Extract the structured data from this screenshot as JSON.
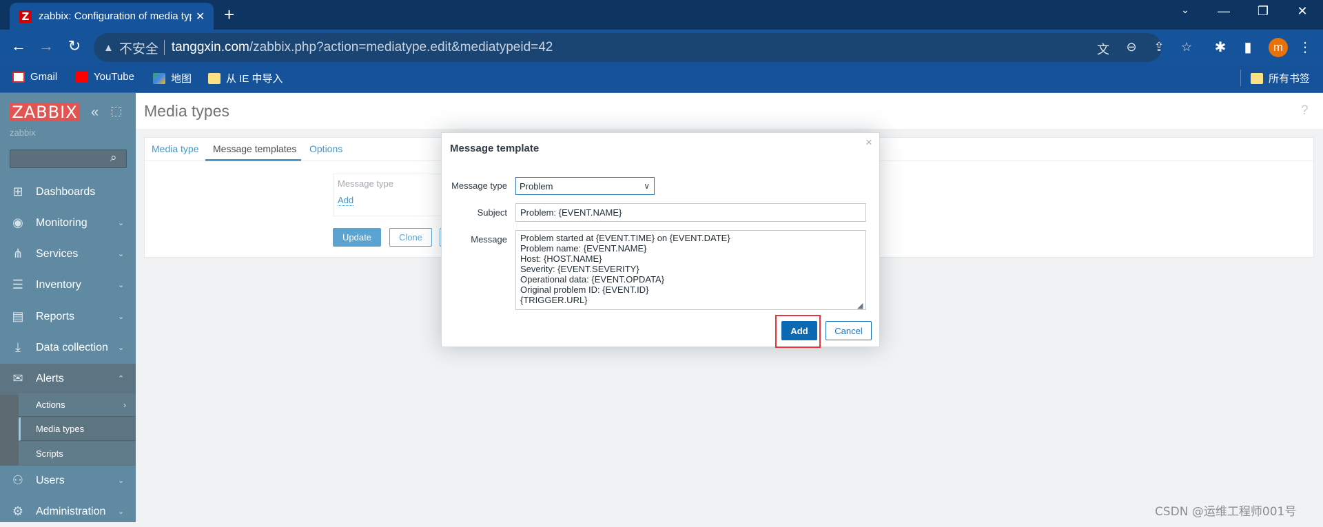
{
  "browser": {
    "tab_title": "zabbix: Configuration of media types",
    "tab_favicon": "Z",
    "window_controls": [
      "tab-search",
      "minimize",
      "restore",
      "close"
    ],
    "insecure_label": "不安全",
    "url_host": "tanggxin.com",
    "url_path": "/zabbix.php?action=mediatype.edit&mediatypeid=42",
    "avatar_letter": "m",
    "bookmarks": [
      "Gmail",
      "YouTube",
      "地图",
      "从 IE 中导入"
    ],
    "all_bookmarks": "所有书签"
  },
  "sidebar": {
    "logo": "ZABBIX",
    "user": "zabbix",
    "search_placeholder": "",
    "items": [
      {
        "label": "Dashboards",
        "icon": "dashboard-icon"
      },
      {
        "label": "Monitoring",
        "icon": "eye-icon"
      },
      {
        "label": "Services",
        "icon": "hierarchy-icon"
      },
      {
        "label": "Inventory",
        "icon": "list-icon"
      },
      {
        "label": "Reports",
        "icon": "report-icon"
      },
      {
        "label": "Data collection",
        "icon": "download-icon"
      },
      {
        "label": "Alerts",
        "icon": "envelope-icon"
      },
      {
        "label": "Users",
        "icon": "users-icon"
      },
      {
        "label": "Administration",
        "icon": "gear-icon"
      }
    ],
    "alerts_sub": [
      "Actions",
      "Media types",
      "Scripts"
    ],
    "active_sub": "Media types"
  },
  "page": {
    "title": "Media types",
    "help": "?",
    "tabs": [
      "Media type",
      "Message templates",
      "Options"
    ],
    "active_tab": "Message templates",
    "templates_header": "Message type",
    "add_link": "Add",
    "update_button": "Update",
    "clone_button": "Clone"
  },
  "modal": {
    "title": "Message template",
    "close": "×",
    "message_type_label": "Message type",
    "message_type_value": "Problem",
    "subject_label": "Subject",
    "subject_value": "Problem: {EVENT.NAME}",
    "message_label": "Message",
    "message_value": "Problem started at {EVENT.TIME} on {EVENT.DATE}\nProblem name: {EVENT.NAME}\nHost: {HOST.NAME}\nSeverity: {EVENT.SEVERITY}\nOperational data: {EVENT.OPDATA}\nOriginal problem ID: {EVENT.ID}\n{TRIGGER.URL}",
    "add_button": "Add",
    "cancel_button": "Cancel",
    "highlight_color": "#e8343a"
  },
  "watermark": "CSDN @运维工程师001号"
}
